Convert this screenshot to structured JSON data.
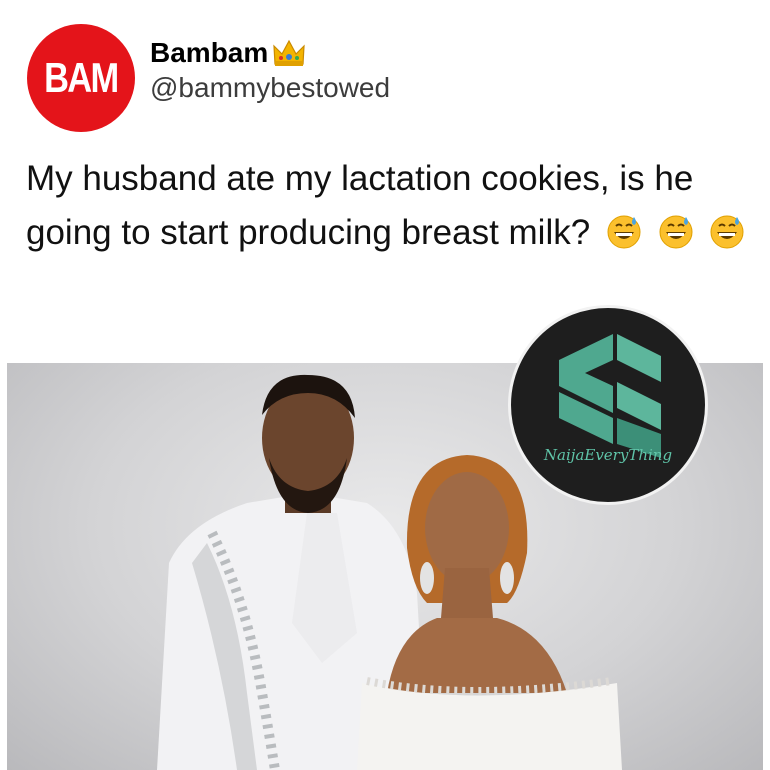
{
  "user": {
    "avatar_text": "BAM",
    "display_name": "Bambam",
    "badge_icon": "crown-icon",
    "handle": "@bammybestowed"
  },
  "tweet": {
    "text": "My husband ate my lactation cookies, is he going to start producing breast milk?",
    "emojis": [
      "grinning-sweat-icon",
      "grinning-sweat-icon",
      "grinning-sweat-icon"
    ]
  },
  "watermark": {
    "brand": "NaijaEveryThing"
  },
  "colors": {
    "avatar_bg": "#e4141a",
    "watermark_bg": "#1e1e1e",
    "logo_teal": "#4fa88f"
  }
}
